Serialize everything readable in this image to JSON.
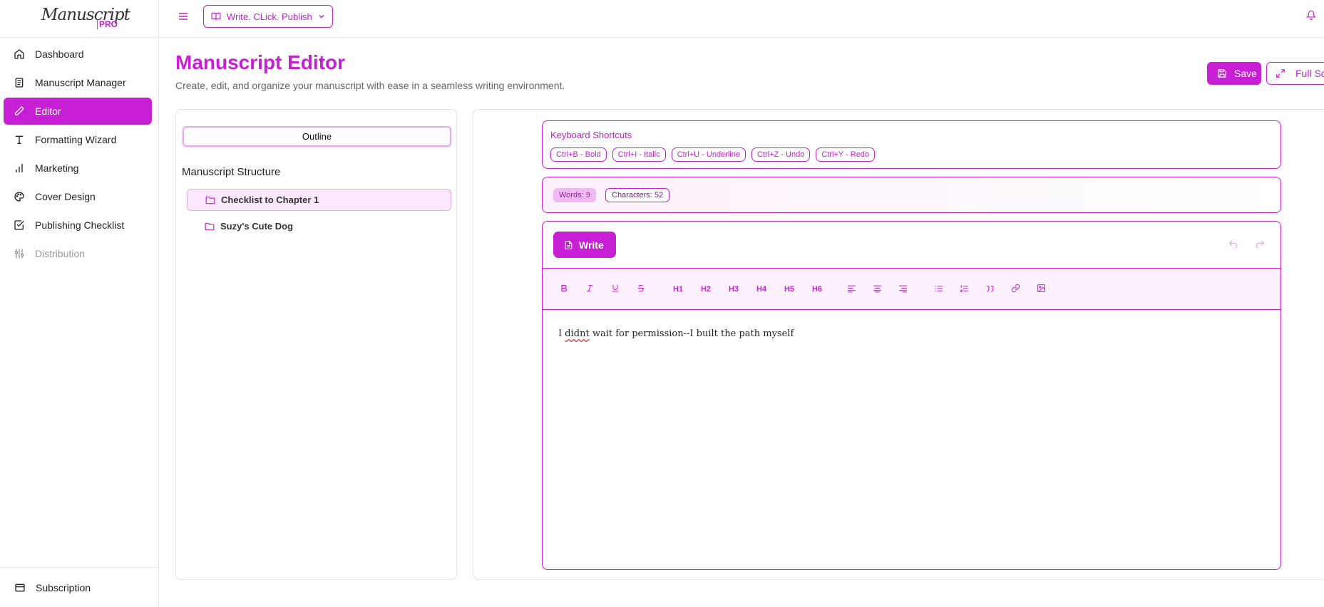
{
  "brand": {
    "logo_script": "Manuscript",
    "logo_badge": "PRO",
    "accent": "#c71fd3"
  },
  "sidebar": {
    "items": [
      {
        "label": "Dashboard",
        "icon": "home-icon"
      },
      {
        "label": "Manuscript Manager",
        "icon": "document-icon"
      },
      {
        "label": "Editor",
        "icon": "pencil-icon",
        "active": true
      },
      {
        "label": "Formatting Wizard",
        "icon": "type-icon"
      },
      {
        "label": "Marketing",
        "icon": "bar-chart-icon"
      },
      {
        "label": "Cover Design",
        "icon": "palette-icon"
      },
      {
        "label": "Publishing Checklist",
        "icon": "checkbox-icon"
      },
      {
        "label": "Distribution",
        "icon": "sliders-icon",
        "disabled": true
      }
    ],
    "footer": {
      "label": "Subscription",
      "icon": "card-icon"
    }
  },
  "topbar": {
    "project": "Write. CLick. Publish"
  },
  "header": {
    "title": "Manuscript Editor",
    "subtitle": "Create, edit, and organize your manuscript with ease in a seamless writing environment.",
    "save_label": "Save",
    "fullscreen_label": "Full Screen"
  },
  "outline": {
    "tab_label": "Outline",
    "structure_title": "Manuscript Structure",
    "items": [
      {
        "label": "Checklist to Chapter 1",
        "selected": true
      },
      {
        "label": "Suzy's Cute Dog",
        "selected": false
      }
    ]
  },
  "shortcuts": {
    "title": "Keyboard Shortcuts",
    "items": [
      "Ctrl+B - Bold",
      "Ctrl+I - Italic",
      "Ctrl+U - Underline",
      "Ctrl+Z - Undo",
      "Ctrl+Y - Redo"
    ]
  },
  "stats": {
    "words": "Words: 9",
    "characters": "Characters: 52"
  },
  "editor": {
    "mode_label": "Write",
    "headings": [
      "H1",
      "H2",
      "H3",
      "H4",
      "H5",
      "H6"
    ],
    "content_prefix": "I ",
    "content_misspelled": "didnt",
    "content_rest": " wait for permission--I built the path myself"
  }
}
